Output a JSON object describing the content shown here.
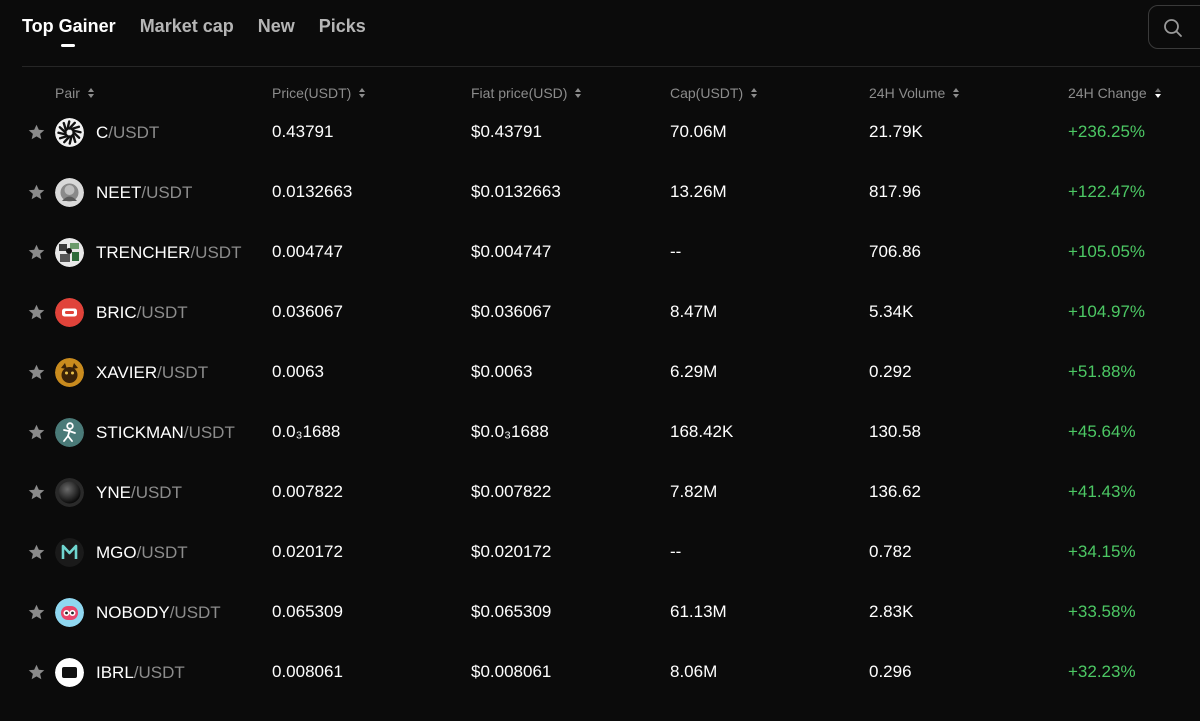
{
  "tabs": [
    {
      "label": "Top Gainer",
      "active": true
    },
    {
      "label": "Market cap",
      "active": false
    },
    {
      "label": "New",
      "active": false
    },
    {
      "label": "Picks",
      "active": false
    }
  ],
  "search": {
    "icon": "search-icon"
  },
  "columns": {
    "pair": "Pair",
    "price": "Price(USDT)",
    "fiat": "Fiat price(USD)",
    "cap": "Cap(USDT)",
    "volume": "24H Volume",
    "change": "24H Change"
  },
  "sorted_column": "24H Change",
  "sort_direction": "desc",
  "colors": {
    "positive": "#4cc864",
    "accent_text": "#ffffff",
    "muted_text": "#8c8c8c"
  },
  "rows": [
    {
      "base": "C",
      "quote": "/USDT",
      "price": "0.43791",
      "fiat": "$0.43791",
      "cap": "70.06M",
      "volume": "21.79K",
      "change": "+236.25%",
      "icon": "c-coin-icon"
    },
    {
      "base": "NEET",
      "quote": "/USDT",
      "price": "0.0132663",
      "fiat": "$0.0132663",
      "cap": "13.26M",
      "volume": "817.96",
      "change": "+122.47%",
      "icon": "neet-coin-icon"
    },
    {
      "base": "TRENCHER",
      "quote": "/USDT",
      "price": "0.004747",
      "fiat": "$0.004747",
      "cap": "--",
      "volume": "706.86",
      "change": "+105.05%",
      "icon": "trencher-coin-icon"
    },
    {
      "base": "BRIC",
      "quote": "/USDT",
      "price": "0.036067",
      "fiat": "$0.036067",
      "cap": "8.47M",
      "volume": "5.34K",
      "change": "+104.97%",
      "icon": "bric-coin-icon"
    },
    {
      "base": "XAVIER",
      "quote": "/USDT",
      "price": "0.0063",
      "fiat": "$0.0063",
      "cap": "6.29M",
      "volume": "0.292",
      "change": "+51.88%",
      "icon": "xavier-coin-icon"
    },
    {
      "base": "STICKMAN",
      "quote": "/USDT",
      "price": "0.0₃1688",
      "fiat": "$0.0₃1688",
      "cap": "168.42K",
      "volume": "130.58",
      "change": "+45.64%",
      "icon": "stickman-coin-icon"
    },
    {
      "base": "YNE",
      "quote": "/USDT",
      "price": "0.007822",
      "fiat": "$0.007822",
      "cap": "7.82M",
      "volume": "136.62",
      "change": "+41.43%",
      "icon": "yne-coin-icon"
    },
    {
      "base": "MGO",
      "quote": "/USDT",
      "price": "0.020172",
      "fiat": "$0.020172",
      "cap": "--",
      "volume": "0.782",
      "change": "+34.15%",
      "icon": "mgo-coin-icon"
    },
    {
      "base": "NOBODY",
      "quote": "/USDT",
      "price": "0.065309",
      "fiat": "$0.065309",
      "cap": "61.13M",
      "volume": "2.83K",
      "change": "+33.58%",
      "icon": "nobody-coin-icon"
    },
    {
      "base": "IBRL",
      "quote": "/USDT",
      "price": "0.008061",
      "fiat": "$0.008061",
      "cap": "8.06M",
      "volume": "0.296",
      "change": "+32.23%",
      "icon": "ibrl-coin-icon"
    }
  ]
}
